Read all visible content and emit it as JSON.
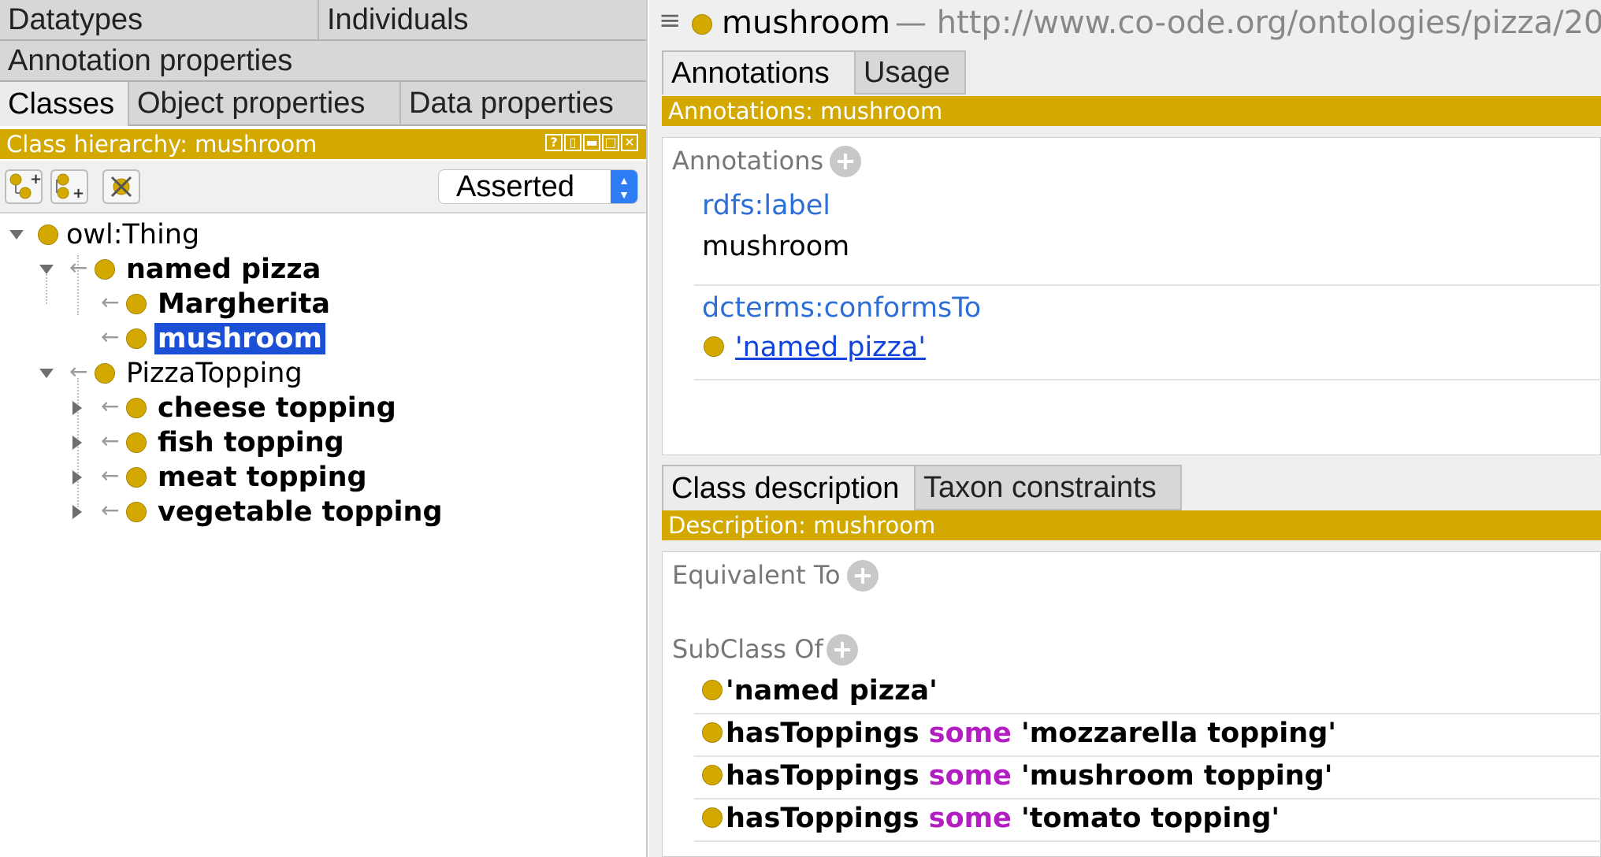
{
  "left": {
    "tabs_row1": [
      "Datatypes",
      "Individuals"
    ],
    "tabs_row2": [
      "Annotation properties"
    ],
    "tabs_row3": [
      "Classes",
      "Object properties",
      "Data properties"
    ],
    "hierarchy_title": "Class hierarchy: mushroom",
    "view_controls": [
      "?",
      "▯",
      "▬",
      "□",
      "✕"
    ],
    "mode": "Asserted",
    "tree": [
      {
        "label": "owl:Thing",
        "bold": false,
        "expanded": true
      },
      {
        "label": "named pizza",
        "bold": true,
        "expanded": true
      },
      {
        "label": "Margherita",
        "bold": true
      },
      {
        "label": "mushroom",
        "bold": true,
        "selected": true
      },
      {
        "label": "PizzaTopping",
        "bold": false,
        "expanded": true
      },
      {
        "label": "cheese topping",
        "bold": true,
        "expanded": false
      },
      {
        "label": "fish topping",
        "bold": true,
        "expanded": false
      },
      {
        "label": "meat topping",
        "bold": true,
        "expanded": false
      },
      {
        "label": "vegetable topping",
        "bold": true,
        "expanded": false
      }
    ]
  },
  "right": {
    "entity_name": "mushroom",
    "entity_iri": "— http://www.co-ode.org/ontologies/pizza/20",
    "top_tabs": [
      "Annotations",
      "Usage"
    ],
    "annotations_title": "Annotations: mushroom",
    "annotations_section": "Annotations",
    "annotations": [
      {
        "property": "rdfs:label",
        "value": "mushroom"
      },
      {
        "property": "dcterms:conformsTo",
        "value": "'named pizza'"
      }
    ],
    "bottom_tabs": [
      "Class description",
      "Taxon constraints"
    ],
    "description_title": "Description: mushroom",
    "equivalent_section": "Equivalent To",
    "subclass_section": "SubClass Of",
    "subclass_axioms": [
      {
        "prop": "'named pizza'",
        "kw": "",
        "filler": ""
      },
      {
        "prop": "hasToppings",
        "kw": "some",
        "filler": "'mozzarella topping'"
      },
      {
        "prop": "hasToppings",
        "kw": "some",
        "filler": "'mushroom topping'"
      },
      {
        "prop": "hasToppings",
        "kw": "some",
        "filler": "'tomato topping'"
      }
    ]
  },
  "colors": {
    "accent": "#d3a900",
    "selection": "#1a4fd6",
    "link": "#2d6fd6",
    "keyword": "#b31ec2"
  }
}
